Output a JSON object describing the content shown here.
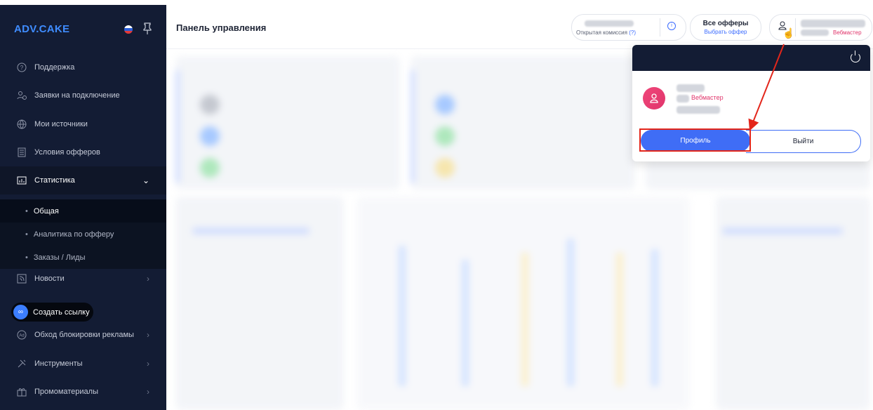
{
  "sidebar": {
    "logo": "ADV.CAKE",
    "items": [
      {
        "label": "Поддержка",
        "icon": "question-icon"
      },
      {
        "label": "Заявки на подключение",
        "icon": "users-icon"
      },
      {
        "label": "Мои источники",
        "icon": "globe-icon"
      },
      {
        "label": "Условия офферов",
        "icon": "document-icon"
      },
      {
        "label": "Статистика",
        "icon": "chart-icon"
      },
      {
        "label": "Новости",
        "icon": "news-icon"
      },
      {
        "label": "Обход блокировки рекламы",
        "icon": "adblock-icon"
      },
      {
        "label": "Инструменты",
        "icon": "tools-icon"
      },
      {
        "label": "Промоматериалы",
        "icon": "gift-icon"
      }
    ],
    "subitems": [
      "Общая",
      "Аналитика по офферу",
      "Заказы / Лиды"
    ],
    "create_link": "Создать ссылку"
  },
  "header": {
    "title": "Панель управления",
    "commission_label": "Открытая комиссия",
    "commission_hint": "(?)",
    "offers_title": "Все офферы",
    "offers_link": "Выбрать оффер",
    "role": "Вебмастер"
  },
  "dropdown": {
    "role": "Вебмастер",
    "profile_button": "Профиль",
    "logout_button": "Выйти"
  },
  "colors": {
    "sidebar_bg": "#131c34",
    "accent": "#3f6df6",
    "role_pink": "#e0356b",
    "annotation_red": "#e3261b"
  }
}
